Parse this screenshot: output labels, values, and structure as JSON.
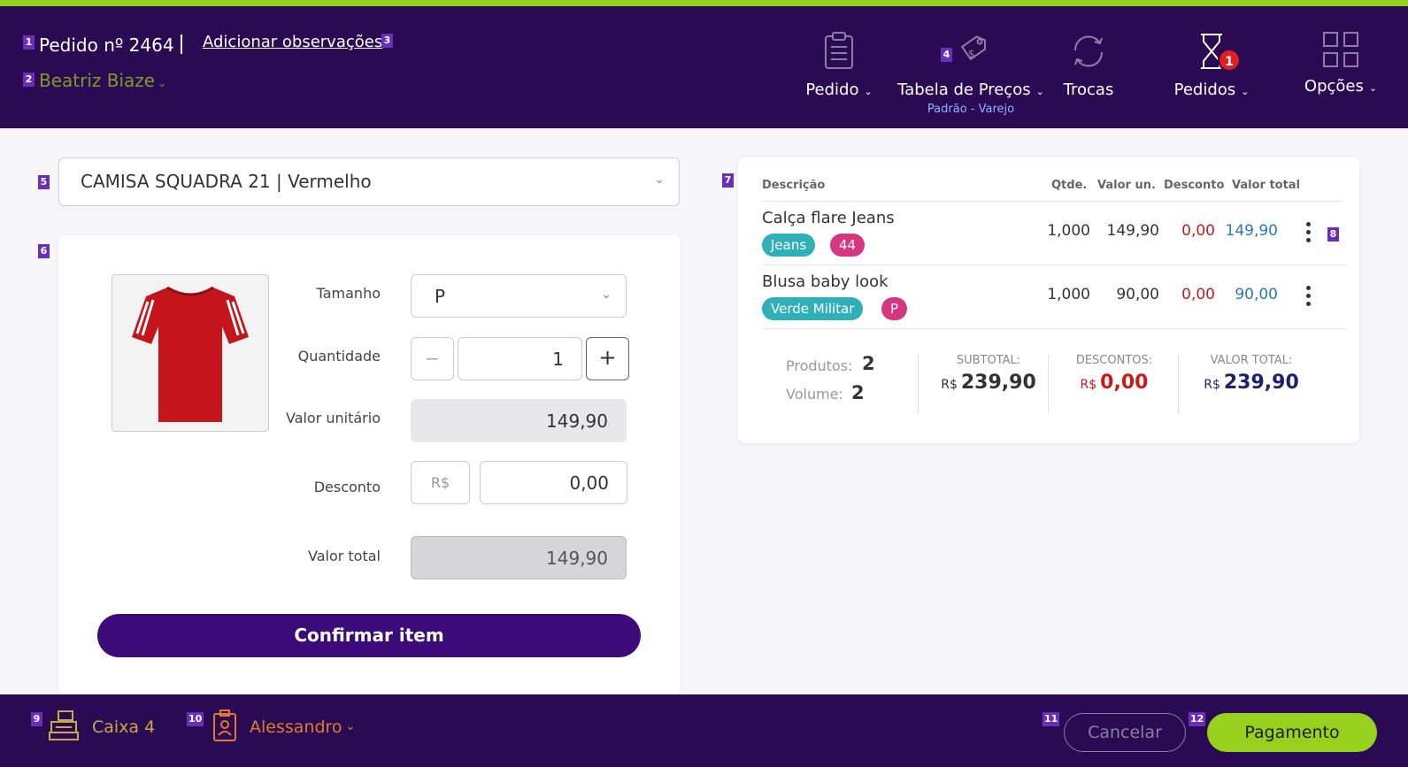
{
  "header": {
    "order_title": "Pedido nº 2464",
    "add_obs_link": "Adicionar observações",
    "customer_name": "Beatriz Biaze",
    "nav": {
      "pedido_label": "Pedido",
      "price_table_label": "Tabela de Preços",
      "price_table_sub": "Padrão - Varejo",
      "trocas_label": "Trocas",
      "pedidos_label": "Pedidos",
      "pedidos_badge": "1",
      "opcoes_label": "Opções"
    }
  },
  "badges": {
    "b1": "1",
    "b2": "2",
    "b3": "3",
    "b4": "4",
    "b5": "5",
    "b6": "6",
    "b7": "7",
    "b8": "8",
    "b9": "9",
    "b10": "10",
    "b11": "11",
    "b12": "12"
  },
  "product_select": {
    "value": "CAMISA SQUADRA 21 | Vermelho"
  },
  "item_form": {
    "size_label": "Tamanho",
    "size_value": "P",
    "qty_label": "Quantidade",
    "qty_value": "1",
    "minus": "−",
    "plus": "+",
    "unit_label": "Valor unitário",
    "unit_value": "149,90",
    "discount_label": "Desconto",
    "discount_currency": "R$",
    "discount_value": "0,00",
    "total_label": "Valor total",
    "total_value": "149,90",
    "confirm_label": "Confirmar item"
  },
  "summary": {
    "columns": {
      "desc": "Descrição",
      "qty": "Qtde.",
      "unit": "Valor un.",
      "discount": "Desconto",
      "total": "Valor total"
    },
    "items": [
      {
        "name": "Calça flare Jeans",
        "tag1": "Jeans",
        "tag2": "44",
        "qty": "1,000",
        "unit": "149,90",
        "discount": "0,00",
        "total": "149,90"
      },
      {
        "name": "Blusa baby look",
        "tag1": "Verde Militar",
        "tag2": "P",
        "qty": "1,000",
        "unit": "90,00",
        "discount": "0,00",
        "total": "90,00"
      }
    ],
    "products_label": "Produtos:",
    "products_value": "2",
    "volume_label": "Volume:",
    "volume_value": "2",
    "subtotal_label": "SUBTOTAL:",
    "subtotal_currency": "R$",
    "subtotal_value": "239,90",
    "discounts_label": "DESCONTOS:",
    "discounts_currency": "R$",
    "discounts_value": "0,00",
    "total_label": "VALOR TOTAL:",
    "total_currency": "R$",
    "total_value": "239,90"
  },
  "footer": {
    "register_label": "Caixa 4",
    "seller_name": "Alessandro",
    "cancel_label": "Cancelar",
    "pay_label": "Pagamento"
  },
  "colors": {
    "accent_green": "#97d01d",
    "header_purple": "#2a0a52",
    "button_purple": "#3d0a7a",
    "teal_tag": "#2fb0b8",
    "pink_tag": "#d6357f",
    "red_value": "#cc1a1a",
    "blue_value": "#2a78b8"
  }
}
